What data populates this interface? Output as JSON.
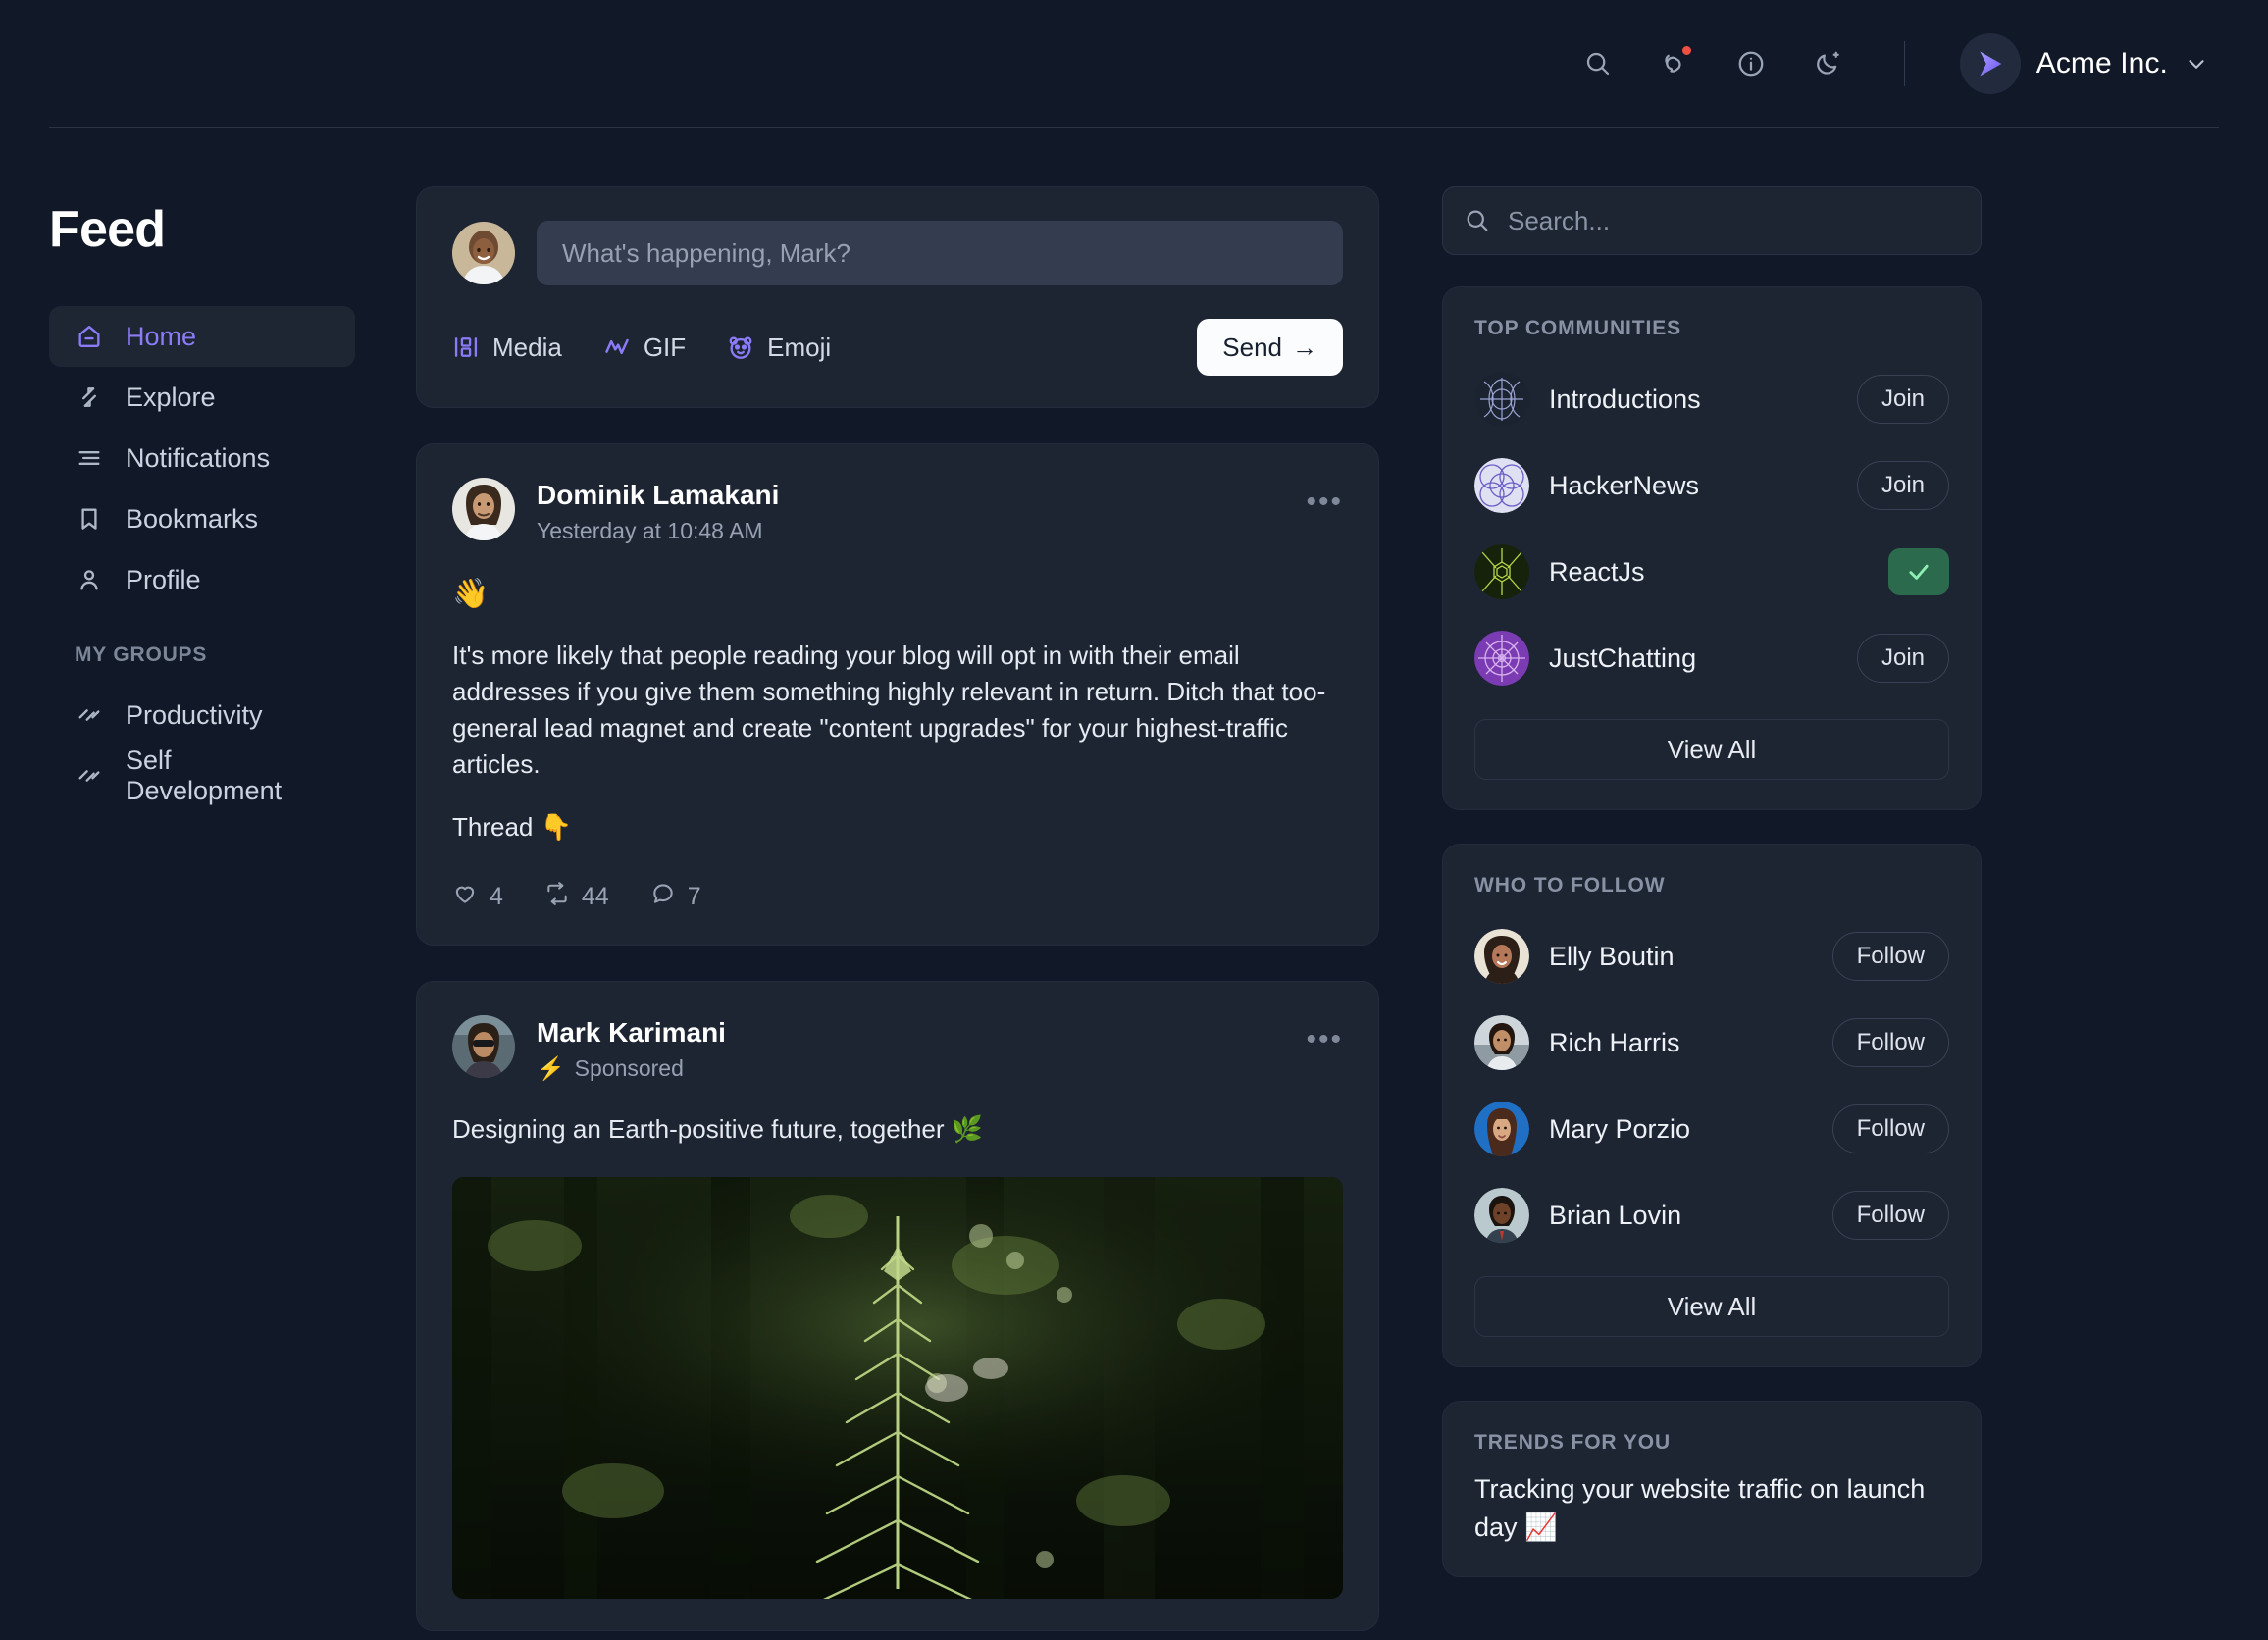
{
  "topbar": {
    "icons": [
      {
        "name": "search-icon",
        "label": "Search"
      },
      {
        "name": "notifications-icon",
        "label": "Notifications",
        "badge": true
      },
      {
        "name": "info-icon",
        "label": "Info"
      },
      {
        "name": "dark-mode-icon",
        "label": "Dark mode"
      }
    ],
    "brand_name": "Acme Inc."
  },
  "sidebar": {
    "title": "Feed",
    "items": [
      {
        "label": "Home",
        "icon": "home-icon",
        "active": true
      },
      {
        "label": "Explore",
        "icon": "explore-icon",
        "active": false
      },
      {
        "label": "Notifications",
        "icon": "notifications-list-icon",
        "active": false
      },
      {
        "label": "Bookmarks",
        "icon": "bookmark-icon",
        "active": false
      },
      {
        "label": "Profile",
        "icon": "profile-icon",
        "active": false
      }
    ],
    "groups_heading": "MY GROUPS",
    "groups": [
      {
        "label": "Productivity",
        "icon": "group-icon"
      },
      {
        "label": "Self Development",
        "icon": "group-icon"
      }
    ]
  },
  "composer": {
    "placeholder": "What's happening, Mark?",
    "value": "",
    "actions": [
      {
        "label": "Media",
        "icon": "media-icon"
      },
      {
        "label": "GIF",
        "icon": "gif-icon"
      },
      {
        "label": "Emoji",
        "icon": "emoji-panda-icon"
      }
    ],
    "send_label": "Send",
    "send_arrow": "→"
  },
  "posts": [
    {
      "author": "Dominik Lamakani",
      "timestamp": "Yesterday at 10:48 AM",
      "emoji_line": "👋",
      "paragraphs": [
        "It's more likely that people reading your blog will opt in with their email addresses if you give them something highly relevant in return. Ditch that too-general lead magnet and create \"content upgrades\" for your highest-traffic articles.",
        "Thread 👇"
      ],
      "stats": {
        "likes": "4",
        "reposts": "44",
        "comments": "7"
      },
      "menu": "•••"
    },
    {
      "author": "Mark Karimani",
      "sponsored_label": "Sponsored",
      "sponsored_icon": "⚡",
      "text": "Designing an Earth-positive future, together 🌿",
      "has_image": true,
      "menu": "•••"
    }
  ],
  "rail": {
    "search_placeholder": "Search...",
    "communities": {
      "title": "TOP COMMUNITIES",
      "items": [
        {
          "name": "Introductions",
          "action": "Join",
          "joined": false
        },
        {
          "name": "HackerNews",
          "action": "Join",
          "joined": false
        },
        {
          "name": "ReactJs",
          "action": "Joined",
          "joined": true
        },
        {
          "name": "JustChatting",
          "action": "Join",
          "joined": false
        }
      ],
      "view_all": "View All"
    },
    "follow": {
      "title": "WHO TO FOLLOW",
      "items": [
        {
          "name": "Elly Boutin",
          "action": "Follow"
        },
        {
          "name": "Rich Harris",
          "action": "Follow"
        },
        {
          "name": "Mary Porzio",
          "action": "Follow"
        },
        {
          "name": "Brian Lovin",
          "action": "Follow"
        }
      ],
      "view_all": "View All"
    },
    "trends": {
      "title": "TRENDS FOR YOU",
      "items": [
        {
          "text": "Tracking your website traffic on launch day 📈"
        }
      ]
    }
  },
  "colors": {
    "page_bg": "#111827",
    "card_bg": "#1d2533",
    "accent": "#8b7bf7",
    "joined_green": "#2c6a4d",
    "badge_red": "#f2503f"
  }
}
